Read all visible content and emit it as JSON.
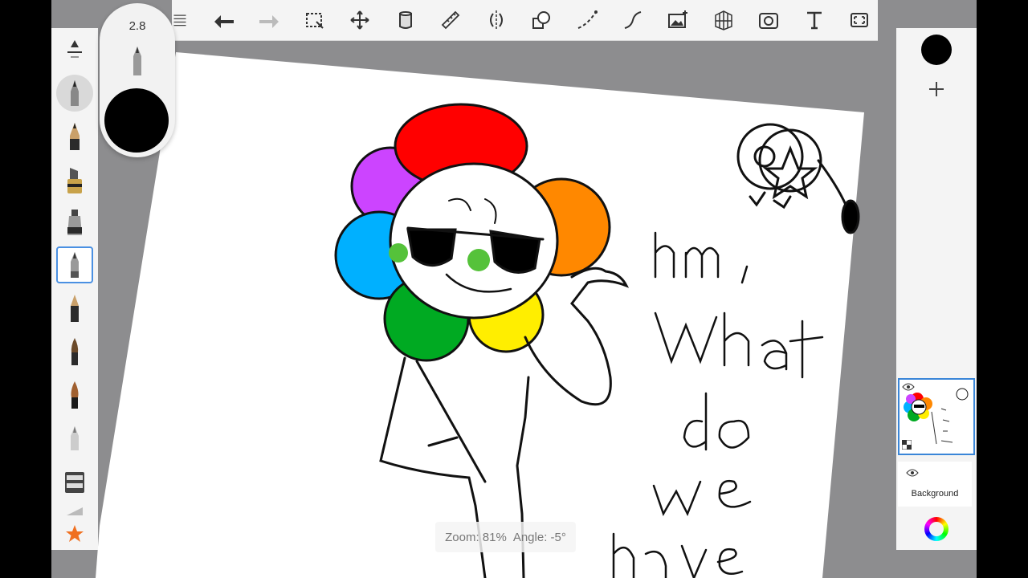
{
  "brush_puck": {
    "size": "2.8",
    "color": "#000000"
  },
  "status": {
    "zoom": "Zoom: 81%",
    "angle": "Angle: -5°"
  },
  "layers": {
    "background_label": "Background"
  },
  "toolbar": {
    "icons": [
      "list-icon",
      "undo-icon",
      "redo-icon",
      "selection-icon",
      "transform-icon",
      "fill-icon",
      "ruler-icon",
      "symmetry-icon",
      "shape-icon",
      "curve-icon",
      "stroke-icon",
      "image-icon",
      "perspective-icon",
      "capture-icon",
      "text-icon",
      "fullscreen-icon"
    ]
  },
  "brushes": [
    "brush-size-slider",
    "pencil-small",
    "pencil",
    "marker",
    "ink-pen",
    "fine-pen",
    "fountain-pen",
    "brush",
    "paint-brush",
    "airbrush",
    "eraser",
    "smudge",
    "favorites-star-icon"
  ],
  "artwork": {
    "handwriting": [
      "hm,",
      "what",
      "do",
      "we",
      "have here"
    ],
    "petal_colors": [
      "#ff0000",
      "#ff8800",
      "#ffee00",
      "#00aa22",
      "#00b0ff",
      "#cc44ff"
    ],
    "cheek_color": "#55c23a",
    "selected_layer_color": "#3a86d8"
  }
}
